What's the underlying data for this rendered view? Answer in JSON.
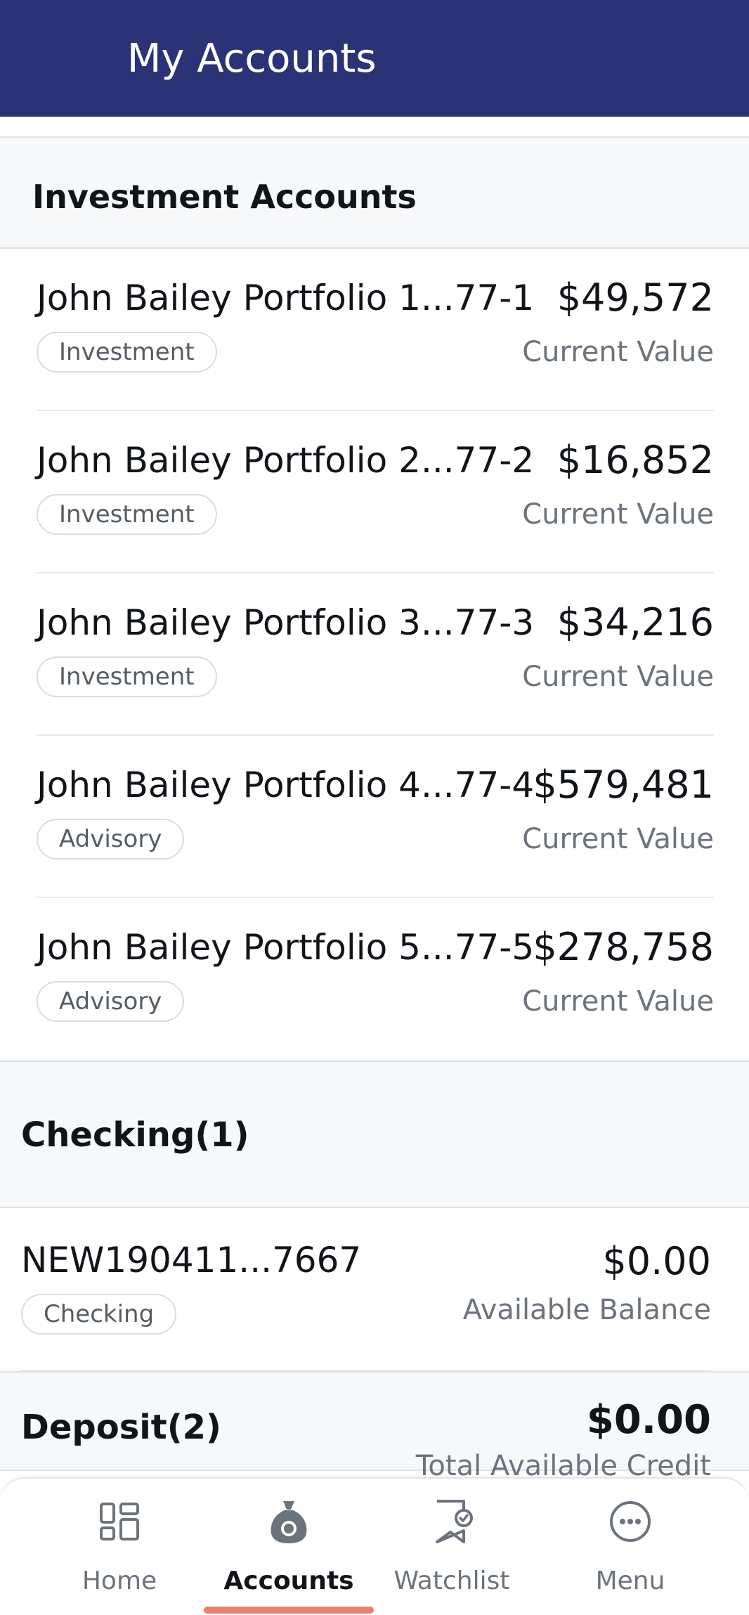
{
  "header": {
    "title": "My Accounts"
  },
  "investment_section": {
    "title": "Investment Accounts",
    "accounts": [
      {
        "name": "John Bailey Portfolio 1...77-1",
        "type": "Investment",
        "amount": "$49,572",
        "amount_label": "Current Value"
      },
      {
        "name": "John Bailey Portfolio 2...77-2",
        "type": "Investment",
        "amount": "$16,852",
        "amount_label": "Current Value"
      },
      {
        "name": "John Bailey Portfolio 3...77-3",
        "type": "Investment",
        "amount": "$34,216",
        "amount_label": "Current Value"
      },
      {
        "name": "John Bailey Portfolio 4...77-4",
        "type": "Advisory",
        "amount": "$579,481",
        "amount_label": "Current Value"
      },
      {
        "name": "John Bailey Portfolio 5...77-5",
        "type": "Advisory",
        "amount": "$278,758",
        "amount_label": "Current Value"
      }
    ]
  },
  "checking_section": {
    "title": "Checking(1)",
    "accounts": [
      {
        "name": "NEW190411...7667",
        "type": "Checking",
        "amount": "$0.00",
        "amount_label": "Available Balance"
      }
    ]
  },
  "deposit_section": {
    "title": "Deposit(2)",
    "total": "$0.00",
    "total_label": "Total Available Credit"
  },
  "bottom_nav": {
    "items": [
      {
        "label": "Home",
        "icon": "grid-icon"
      },
      {
        "label": "Accounts",
        "icon": "money-bag-icon",
        "active": true
      },
      {
        "label": "Watchlist",
        "icon": "bookmark-check-icon"
      },
      {
        "label": "Menu",
        "icon": "more-circle-icon"
      }
    ]
  },
  "colors": {
    "header_bg": "#2a3375",
    "active_indicator": "#e8806a",
    "section_bg": "#f7f8f9",
    "muted_text": "#6c737d"
  }
}
